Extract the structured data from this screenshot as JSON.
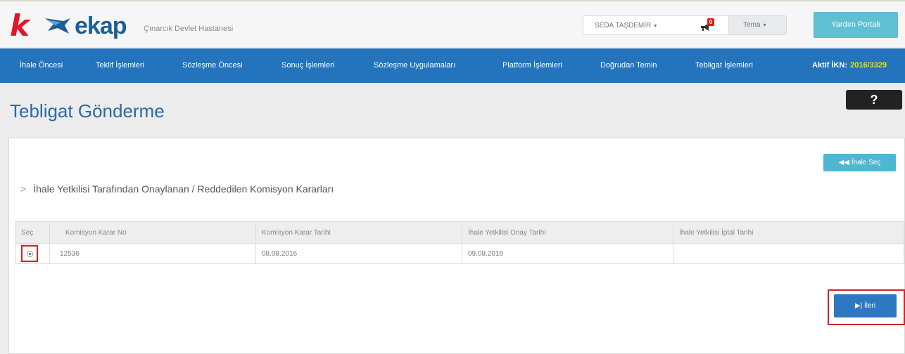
{
  "header": {
    "logo_letter": "k",
    "logo_text": "ekap",
    "institution": "Çınarcık Devlet Hastanesi",
    "user_name": "SEDA TAŞDEMİR",
    "notification_count": "0",
    "theme_label": "Tema",
    "help_portal_label": "Yardım Portalı"
  },
  "nav": {
    "items": [
      {
        "label": "İhale Öncesi"
      },
      {
        "label": "Teklif İşlemleri"
      },
      {
        "label": "Sözleşme Öncesi"
      },
      {
        "label": "Sonuç İşlemleri"
      },
      {
        "label": "Sözleşme Uygulamaları"
      },
      {
        "label": "Platform İşlemleri"
      },
      {
        "label": "Doğrudan Temin"
      },
      {
        "label": "Tebligat İşlemleri"
      }
    ],
    "aktif_label": "Aktif İKN:",
    "aktif_value": "2016/3329"
  },
  "page": {
    "title": "Tebligat Gönderme",
    "help_button": "?"
  },
  "panel": {
    "ihale_sec_label": "İhale Seç",
    "section_title": "İhale Yetkilisi Tarafından Onaylanan / Reddedilen Komisyon Kararları",
    "table": {
      "headers": [
        "Seç",
        "Komisyon Karar No",
        "Komisyon Karar Tarihi",
        "İhale Yetkilisi Onay Tarihi",
        "İhale Yetkilisi İptal Tarihi"
      ],
      "rows": [
        {
          "karar_no": "12536",
          "karar_tarihi": "08.08.2016",
          "onay_tarihi": "09.08.2016",
          "iptal_tarihi": ""
        }
      ]
    },
    "ileri_label": "İleri"
  },
  "icons": {
    "chevron": "chevron-right-icon",
    "bell": "megaphone-icon",
    "back": "double-arrow-left-icon",
    "forward": "step-forward-icon"
  },
  "colors": {
    "nav_bg": "#2373bd",
    "brand_red": "#e0162b",
    "highlight_red": "#d4222a",
    "aktif_ikn": "#e7e31f"
  }
}
